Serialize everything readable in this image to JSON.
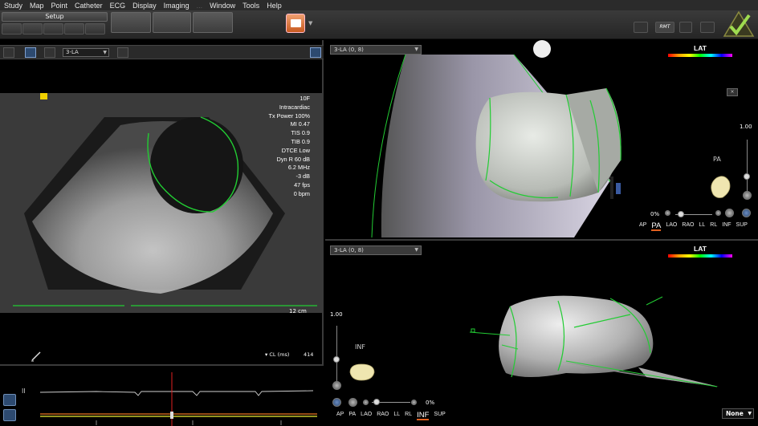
{
  "menu": {
    "items": [
      "Study",
      "Map",
      "Point",
      "Catheter",
      "ECG",
      "Display",
      "Imaging",
      "...",
      "Window",
      "Tools",
      "Help"
    ]
  },
  "toolbar": {
    "setup_label": "Setup"
  },
  "ultrasound": {
    "view_select": "3-LA",
    "info": [
      "10F",
      "Intracardiac",
      "Tx Power 100%",
      "MI 0.47",
      "TIS 0.9",
      "TIB 0.9",
      "DTCE Low",
      "Dyn R 60 dB",
      "6.2 MHz",
      "-3 dB",
      "47 fps",
      "0 bpm"
    ],
    "depth": "12 cm"
  },
  "ecg": {
    "cl_label": "CL (ms)",
    "cl_value": "414"
  },
  "map_top": {
    "select": "3-LA (0, 8)",
    "lat_title": "LAT",
    "zoom_pct": "0%",
    "scale_value": "1.00",
    "orientation_label": "PA",
    "views": [
      "AP",
      "PA",
      "LAO",
      "RAO",
      "LL",
      "RL",
      "INF",
      "SUP"
    ],
    "active_view": "PA"
  },
  "map_bottom": {
    "select": "3-LA (0, 8)",
    "lat_title": "LAT",
    "zoom_pct": "0%",
    "scale_value": "1.00",
    "orientation_label": "INF",
    "views": [
      "AP",
      "PA",
      "LAO",
      "RAO",
      "LL",
      "RL",
      "INF",
      "SUP"
    ],
    "active_view": "INF"
  },
  "none_select": "None",
  "colors": {
    "accent": "#e06020",
    "contour": "#22cc33",
    "panel_bg": "#000000"
  }
}
